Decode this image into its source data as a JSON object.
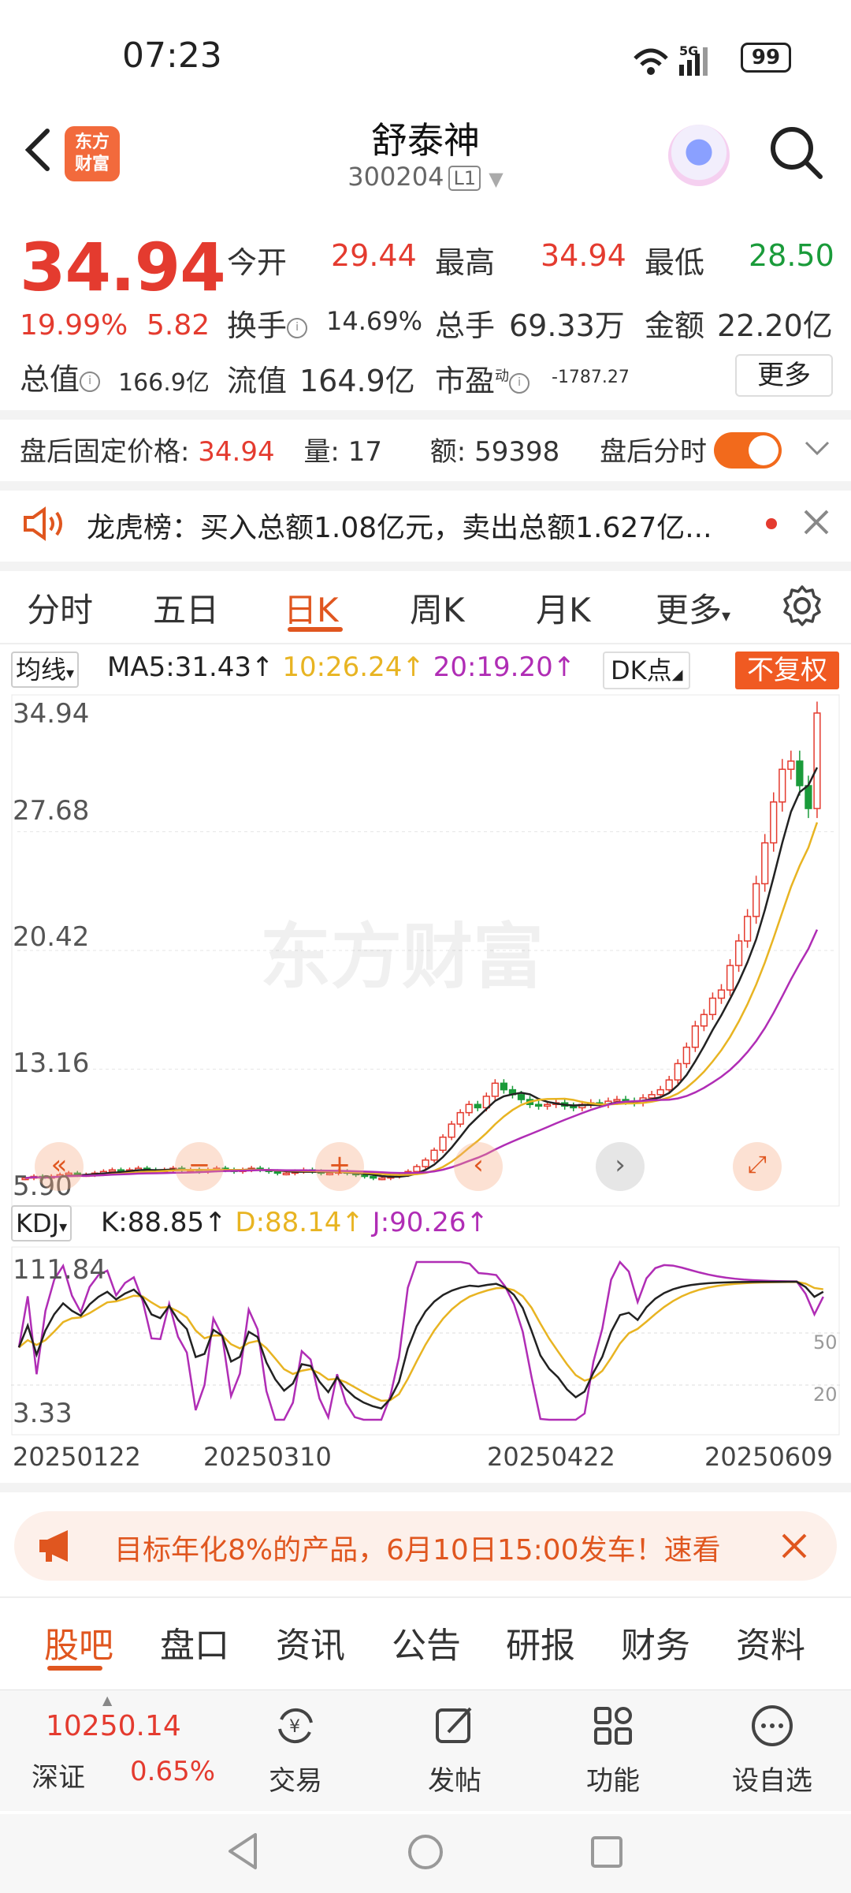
{
  "status": {
    "time": "07:23",
    "network": "5G",
    "battery": "99"
  },
  "header": {
    "stock_name": "舒泰神",
    "stock_code": "300204",
    "level_tag": "L1",
    "logo_text": "东方财富"
  },
  "quote": {
    "price": "34.94",
    "pct": "19.99%",
    "change": "5.82",
    "open_label": "今开",
    "open": "29.44",
    "high_label": "最高",
    "high": "34.94",
    "low_label": "最低",
    "low": "28.50",
    "turnover_label": "换手",
    "turnover": "14.69%",
    "volume_label": "总手",
    "volume": "69.33万",
    "amount_label": "金额",
    "amount": "22.20亿",
    "mktcap_label": "总值",
    "mktcap": "166.9亿",
    "float_label": "流值",
    "float": "164.9亿",
    "pe_label": "市盈",
    "pe_super": "动",
    "pe": "-1787.27",
    "more": "更多"
  },
  "after_hours": {
    "price_label": "盘后固定价格:",
    "price": "34.94",
    "vol_label": "量:",
    "vol": "17",
    "amt_label": "额:",
    "amt": "59398",
    "toggle_label": "盘后分时"
  },
  "dragon_tiger": {
    "text": "龙虎榜：买入总额1.08亿元，卖出总额1.627亿..."
  },
  "chart_tabs": [
    "分时",
    "五日",
    "日K",
    "周K",
    "月K",
    "更多"
  ],
  "chart_tab_more_arrow": "▾",
  "ma": {
    "button": "均线",
    "ma5": "MA5:31.43↑",
    "ma10": "10:26.24↑",
    "ma20": "20:19.20↑",
    "dk": "DK点",
    "fuquan": "不复权"
  },
  "colors": {
    "up": "#e43b2f",
    "down": "#1a9b3a",
    "accent": "#e0561f",
    "ma10": "#e8b422",
    "ma20": "#b02db5"
  },
  "chart_data": {
    "type": "candlestick",
    "y_ticks": [
      "34.94",
      "27.68",
      "20.42",
      "13.16",
      "5.90"
    ],
    "ylim": [
      5.9,
      34.94
    ],
    "x_ticks": [
      "20250122",
      "20250310",
      "20250422",
      "20250609"
    ],
    "close_approx": [
      6.5,
      6.6,
      6.5,
      6.6,
      6.7,
      6.8,
      6.7,
      6.7,
      6.8,
      6.9,
      7.0,
      6.9,
      7.0,
      7.1,
      7.0,
      6.9,
      7.0,
      7.1,
      7.0,
      7.0,
      6.9,
      7.0,
      7.1,
      7.0,
      6.9,
      7.0,
      7.1,
      7.0,
      6.9,
      6.8,
      6.8,
      6.9,
      7.0,
      6.9,
      6.8,
      6.8,
      6.9,
      6.8,
      6.7,
      6.6,
      6.5,
      6.5,
      6.6,
      6.7,
      6.9,
      7.2,
      7.6,
      8.2,
      9.0,
      9.8,
      10.5,
      11.0,
      10.8,
      11.5,
      12.3,
      11.9,
      11.6,
      11.3,
      11.0,
      10.9,
      11.0,
      11.1,
      10.9,
      10.8,
      11.0,
      11.1,
      11.0,
      11.2,
      11.3,
      11.2,
      11.1,
      11.4,
      11.6,
      11.9,
      12.5,
      13.5,
      14.5,
      15.8,
      16.5,
      17.5,
      18.0,
      19.5,
      21.0,
      22.5,
      24.5,
      27.0,
      29.5,
      31.5,
      32.0,
      30.5,
      29.1,
      34.94
    ],
    "kdj": {
      "K": "88.85",
      "D": "88.14",
      "J": "90.26",
      "y_ticks": [
        "111.84",
        "3.33"
      ],
      "levels": [
        "50",
        "20"
      ]
    }
  },
  "kdj_row": {
    "button": "KDJ",
    "k": "K:88.85↑",
    "d": "D:88.14↑",
    "j": "J:90.26↑"
  },
  "banner": {
    "text": "目标年化8%的产品，6月10日15:00发车！速看"
  },
  "bottom_tabs": [
    "股吧",
    "盘口",
    "资讯",
    "公告",
    "研报",
    "财务",
    "资料"
  ],
  "nav": {
    "index_value": "10250.14",
    "index_name": "深证",
    "index_pct": "0.65%",
    "items": [
      "交易",
      "发帖",
      "功能",
      "设自选"
    ]
  }
}
